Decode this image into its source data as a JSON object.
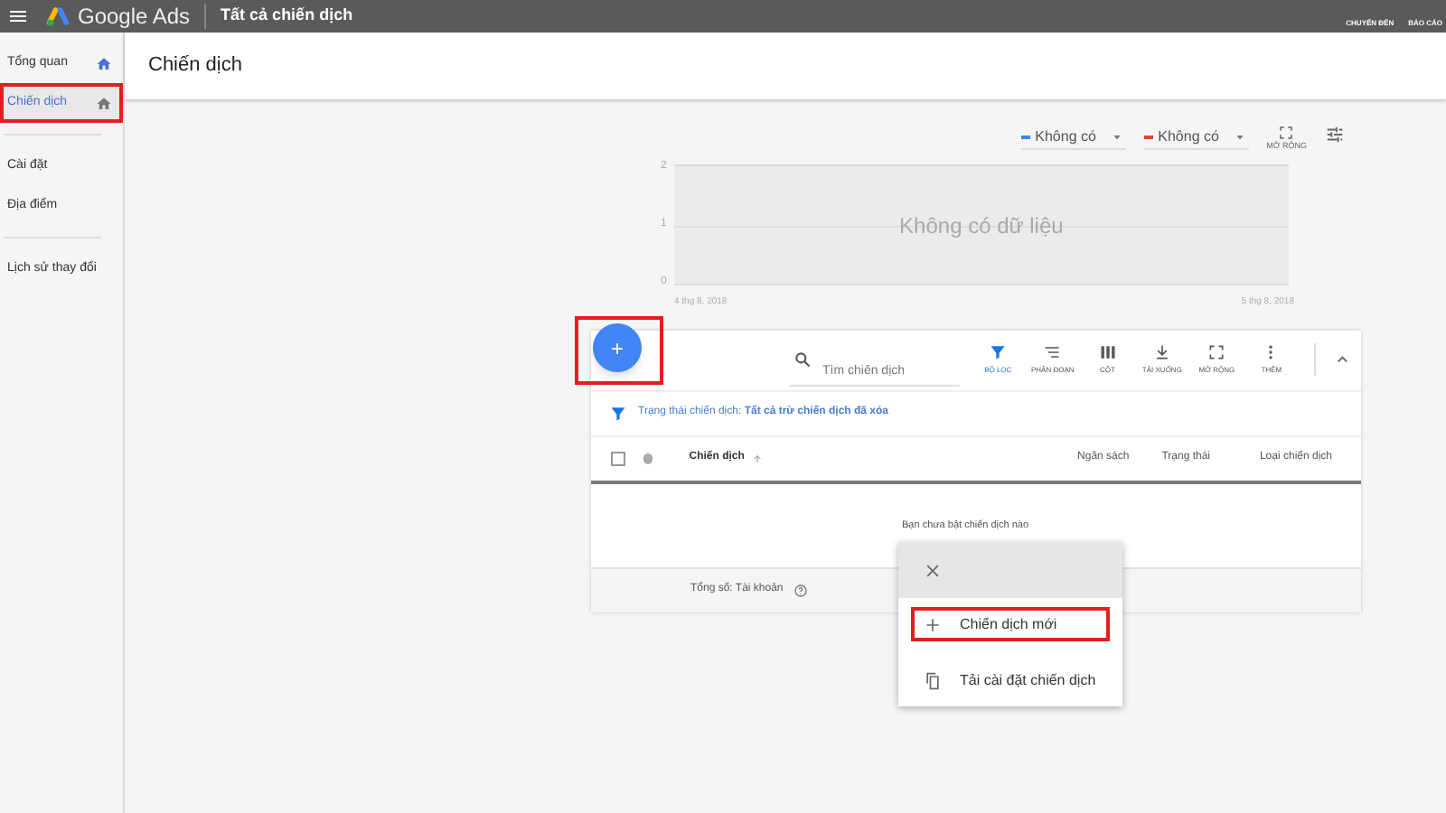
{
  "top_bar": {
    "product": "Google Ads",
    "title": "Tất cả chiến dịch",
    "actions": [
      {
        "label": "CHUYỂN ĐẾN"
      },
      {
        "label": "BÁO CÁO"
      }
    ]
  },
  "sidebar": {
    "groups": [
      [
        {
          "label": "Tổng quan",
          "selected": false,
          "highlighted": false
        },
        {
          "label": "Chiến dịch",
          "selected": true,
          "highlighted": true
        }
      ],
      [
        {
          "label": "Cài đặt",
          "selected": false,
          "highlighted": false
        },
        {
          "label": "Địa điểm",
          "selected": false,
          "highlighted": false
        }
      ],
      [
        {
          "label": "Lịch sử thay đổi",
          "selected": false,
          "highlighted": false
        }
      ]
    ]
  },
  "page_title": "Chiến dịch",
  "chart_controls": {
    "metrics": [
      {
        "label": "Không có",
        "color": "#4285f4"
      },
      {
        "label": "Không có",
        "color": "#db4437"
      }
    ],
    "expand_label": "MỞ RỘNG"
  },
  "chart": {
    "y_labels": [
      "2",
      "1",
      "0"
    ],
    "x_labels": [
      "4 thg 8, 2018",
      "5 thg 8, 2018"
    ],
    "empty_message": "Không có dữ liệu"
  },
  "fab": {
    "label": "+",
    "highlighted": true
  },
  "table": {
    "search_placeholder": "Tìm chiến dịch",
    "tools": [
      {
        "label": "BỘ LỌC",
        "selected": true
      },
      {
        "label": "PHÂN ĐOẠN",
        "selected": false
      },
      {
        "label": "CỘT",
        "selected": false
      },
      {
        "label": "TẢI XUỐNG",
        "selected": false
      },
      {
        "label": "MỞ RỘNG",
        "selected": false
      },
      {
        "label": "THÊM",
        "selected": false
      }
    ],
    "select_all": {
      "checked": false
    },
    "filter": "Trạng thái chiến dịch: **Tất cả trừ chiến dịch đã xóa**",
    "columns": [
      {
        "label": "Chiến dịch",
        "sorted": true
      },
      {
        "label": "Ngân sách",
        "sorted": false
      },
      {
        "label": "Trạng thái",
        "sorted": false
      },
      {
        "label": "Loại chiến dịch",
        "sorted": false
      }
    ],
    "empty_message": "Bạn chưa bật chiến dịch nào",
    "footer": "Tổng số: Tài khoản"
  },
  "menu": {
    "items": [
      {
        "label": "Chiến dịch mới",
        "highlighted": true
      },
      {
        "label": "Tải cài đặt chiến dịch",
        "highlighted": false
      }
    ]
  }
}
